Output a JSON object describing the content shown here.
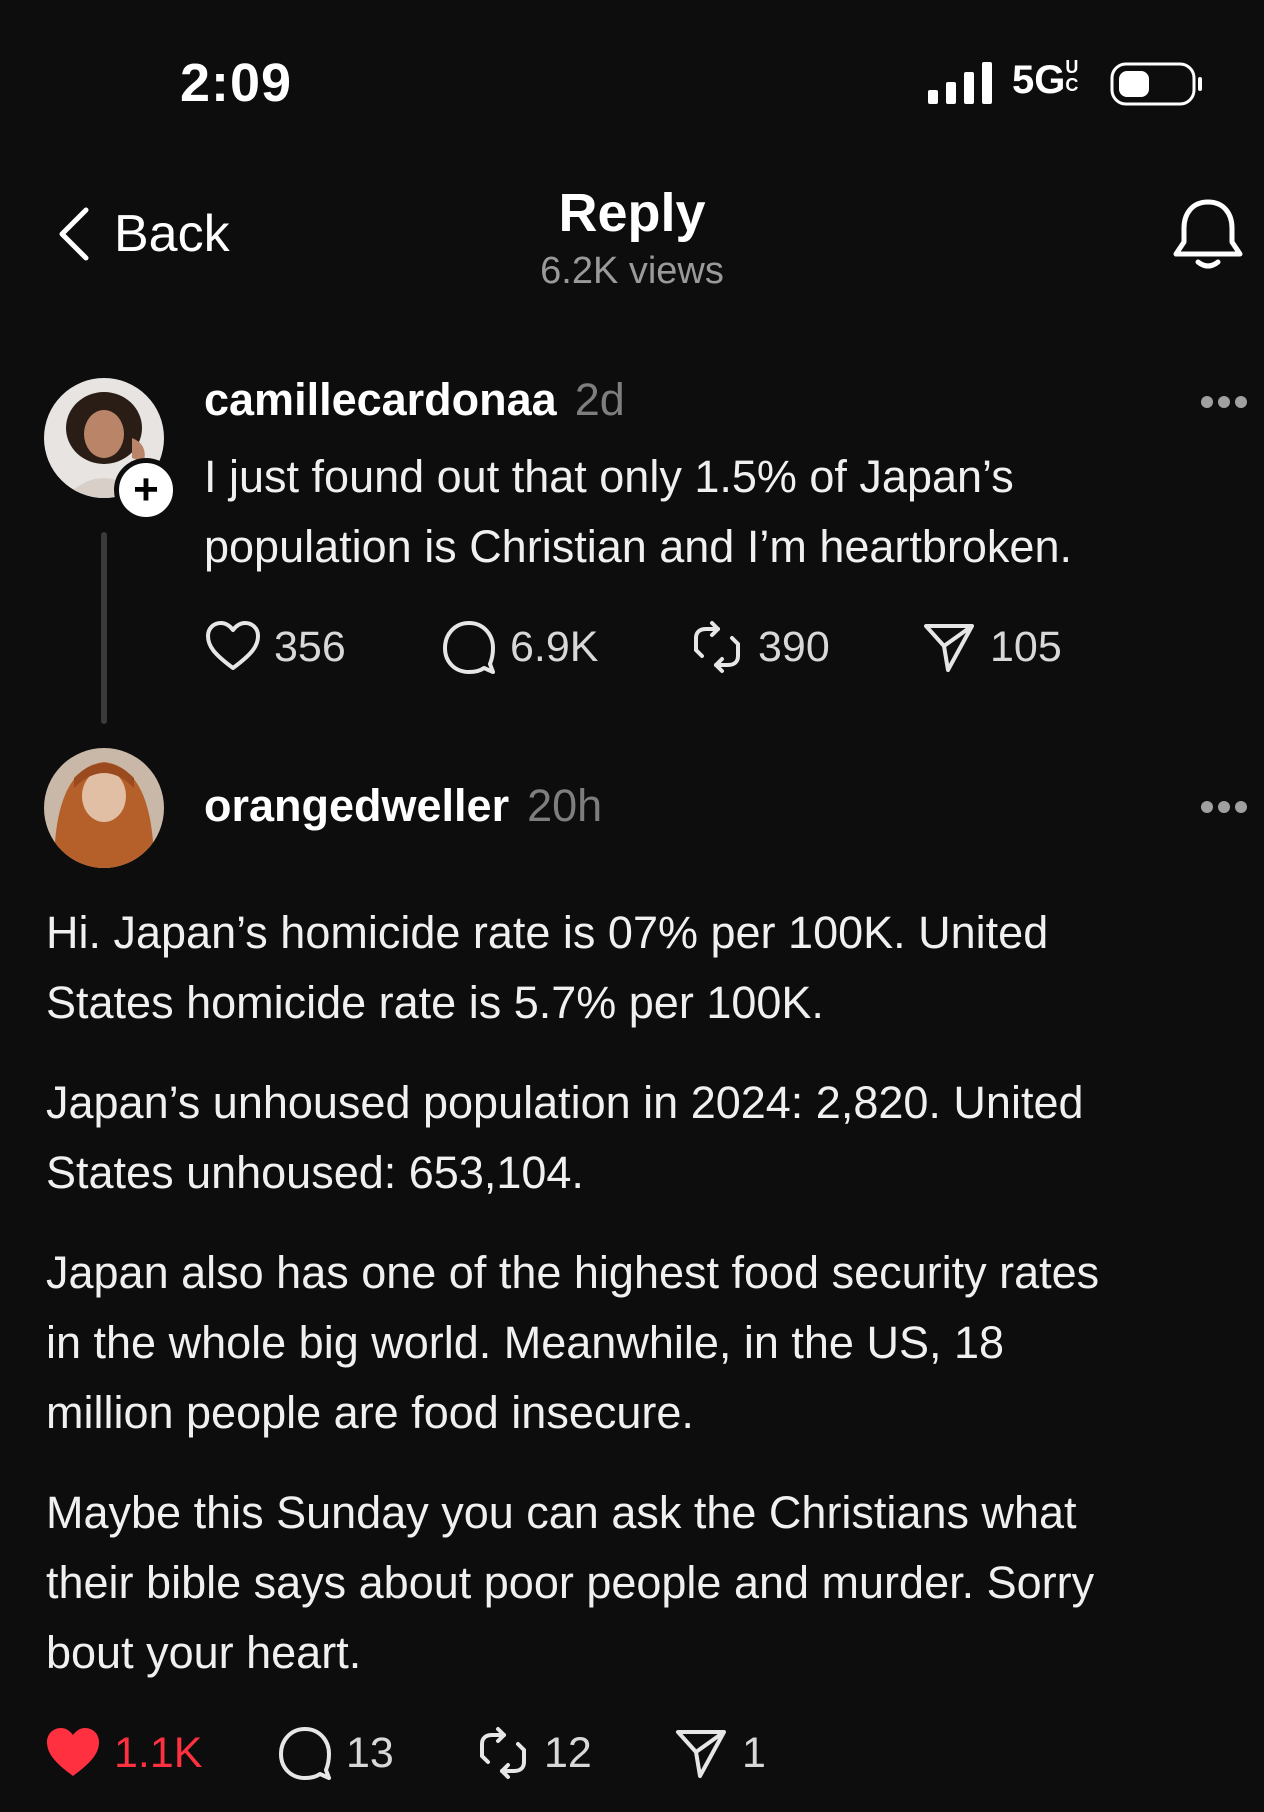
{
  "status_bar": {
    "time": "2:09",
    "network": "5G",
    "network_sup": "UC"
  },
  "header": {
    "back_label": "Back",
    "title": "Reply",
    "views": "6.2K views"
  },
  "post": {
    "username": "camillecardonaa",
    "time_ago": "2d",
    "text_lines": [
      "I just found out that only 1.5% of Japan’s",
      "population is Christian and I’m heartbroken."
    ],
    "likes": "356",
    "replies": "6.9K",
    "reposts": "390",
    "shares": "105"
  },
  "reply": {
    "username": "orangedweller",
    "time_ago": "20h",
    "paragraphs": [
      [
        "Hi. Japan’s homicide rate is 07% per 100K. United",
        "States homicide rate is 5.7% per 100K."
      ],
      [
        "Japan’s unhoused population in 2024: 2,820. United",
        "States unhoused: 653,104."
      ],
      [
        "Japan also has one of the highest food security rates",
        "in the whole big world. Meanwhile, in the US, 18",
        "million people are food insecure."
      ],
      [
        "Maybe this Sunday you can ask the Christians what",
        "their bible says about poor people and murder. Sorry",
        "bout your heart."
      ]
    ],
    "likes": "1.1K",
    "replies": "13",
    "reposts": "12",
    "shares": "1"
  },
  "colors": {
    "background": "#0d0d0d",
    "liked_red": "#ff3040",
    "muted": "#7e7e7e"
  }
}
